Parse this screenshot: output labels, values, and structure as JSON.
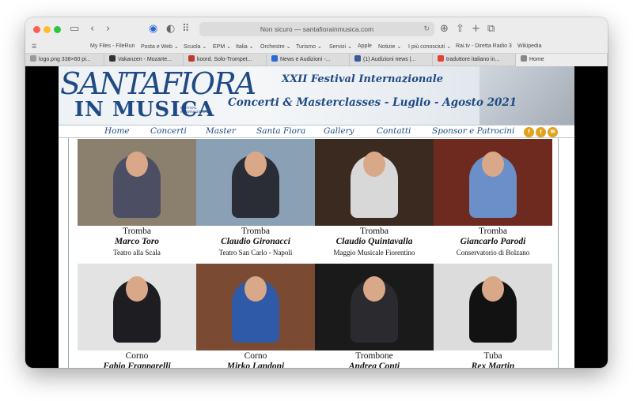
{
  "browser": {
    "address": "Non sicuro — santafiorainmusica.com",
    "favorites": [
      "My Files - FileRun",
      "Posta e Web ⌄",
      "Scuola ⌄",
      "EPM ⌄",
      "Italia ⌄",
      "Orchestre ⌄",
      "Turismo ⌄",
      "Servizi ⌄",
      "Apple",
      "Notizie ⌄",
      "I più conosciuti ⌄",
      "Rai.tv - Diretta Radio 3",
      "Wikipedia"
    ],
    "tabs": [
      "logo.png 338×60 pi...",
      "Vakanzen - Mozarte...",
      "koord. Solo-Trompet...",
      "News e Audizioni -...",
      "(1) Audizioni news |...",
      "traduttore italiano in...",
      "Home"
    ]
  },
  "header": {
    "logo_line1": "SANTAFIORA",
    "logo_line2": "IN MUSICA",
    "logo_small": "FESTIVAL INTERNAZIONALE",
    "festival": "XXII Festival Internazionale",
    "subtitle": "Concerti & Masterclasses  -  Luglio - Agosto 2021"
  },
  "nav": [
    "Home",
    "Concerti",
    "Master",
    "Santa Fiora",
    "Gallery",
    "Contatti",
    "Sponsor e Patrocini"
  ],
  "social": [
    "f",
    "t",
    "✉"
  ],
  "teachers": [
    {
      "instrument": "Tromba",
      "name": "Marco Toro",
      "institution": "Teatro alla Scala",
      "bg": "#8b7f6e",
      "body": "#4c4e63"
    },
    {
      "instrument": "Tromba",
      "name": "Claudio Gironacci",
      "institution": "Teatro San Carlo - Napoli",
      "bg": "#8aa0b5",
      "body": "#2a2d36"
    },
    {
      "instrument": "Tromba",
      "name": "Claudio Quintavalla",
      "institution": "Maggio Musicale Fiorentino",
      "bg": "#3b2a20",
      "body": "#d8d8d8"
    },
    {
      "instrument": "Tromba",
      "name": "Giancarlo Parodi",
      "institution": "Conservatorio di Bolzano",
      "bg": "#6e2a1e",
      "body": "#6a8fc9"
    },
    {
      "instrument": "Corno",
      "name": "Fabio Frapparelli",
      "institution": "",
      "bg": "#e3e3e3",
      "body": "#1d1d22"
    },
    {
      "instrument": "Corno",
      "name": "Mirko Landoni",
      "institution": "",
      "bg": "#7a4a32",
      "body": "#2f5aa8"
    },
    {
      "instrument": "Trombone",
      "name": "Andrea Conti",
      "institution": "",
      "bg": "#1a1a1a",
      "body": "#2b2b2f"
    },
    {
      "instrument": "Tuba",
      "name": "Rex Martin",
      "institution": "",
      "bg": "#dcdcdc",
      "body": "#121212"
    }
  ]
}
